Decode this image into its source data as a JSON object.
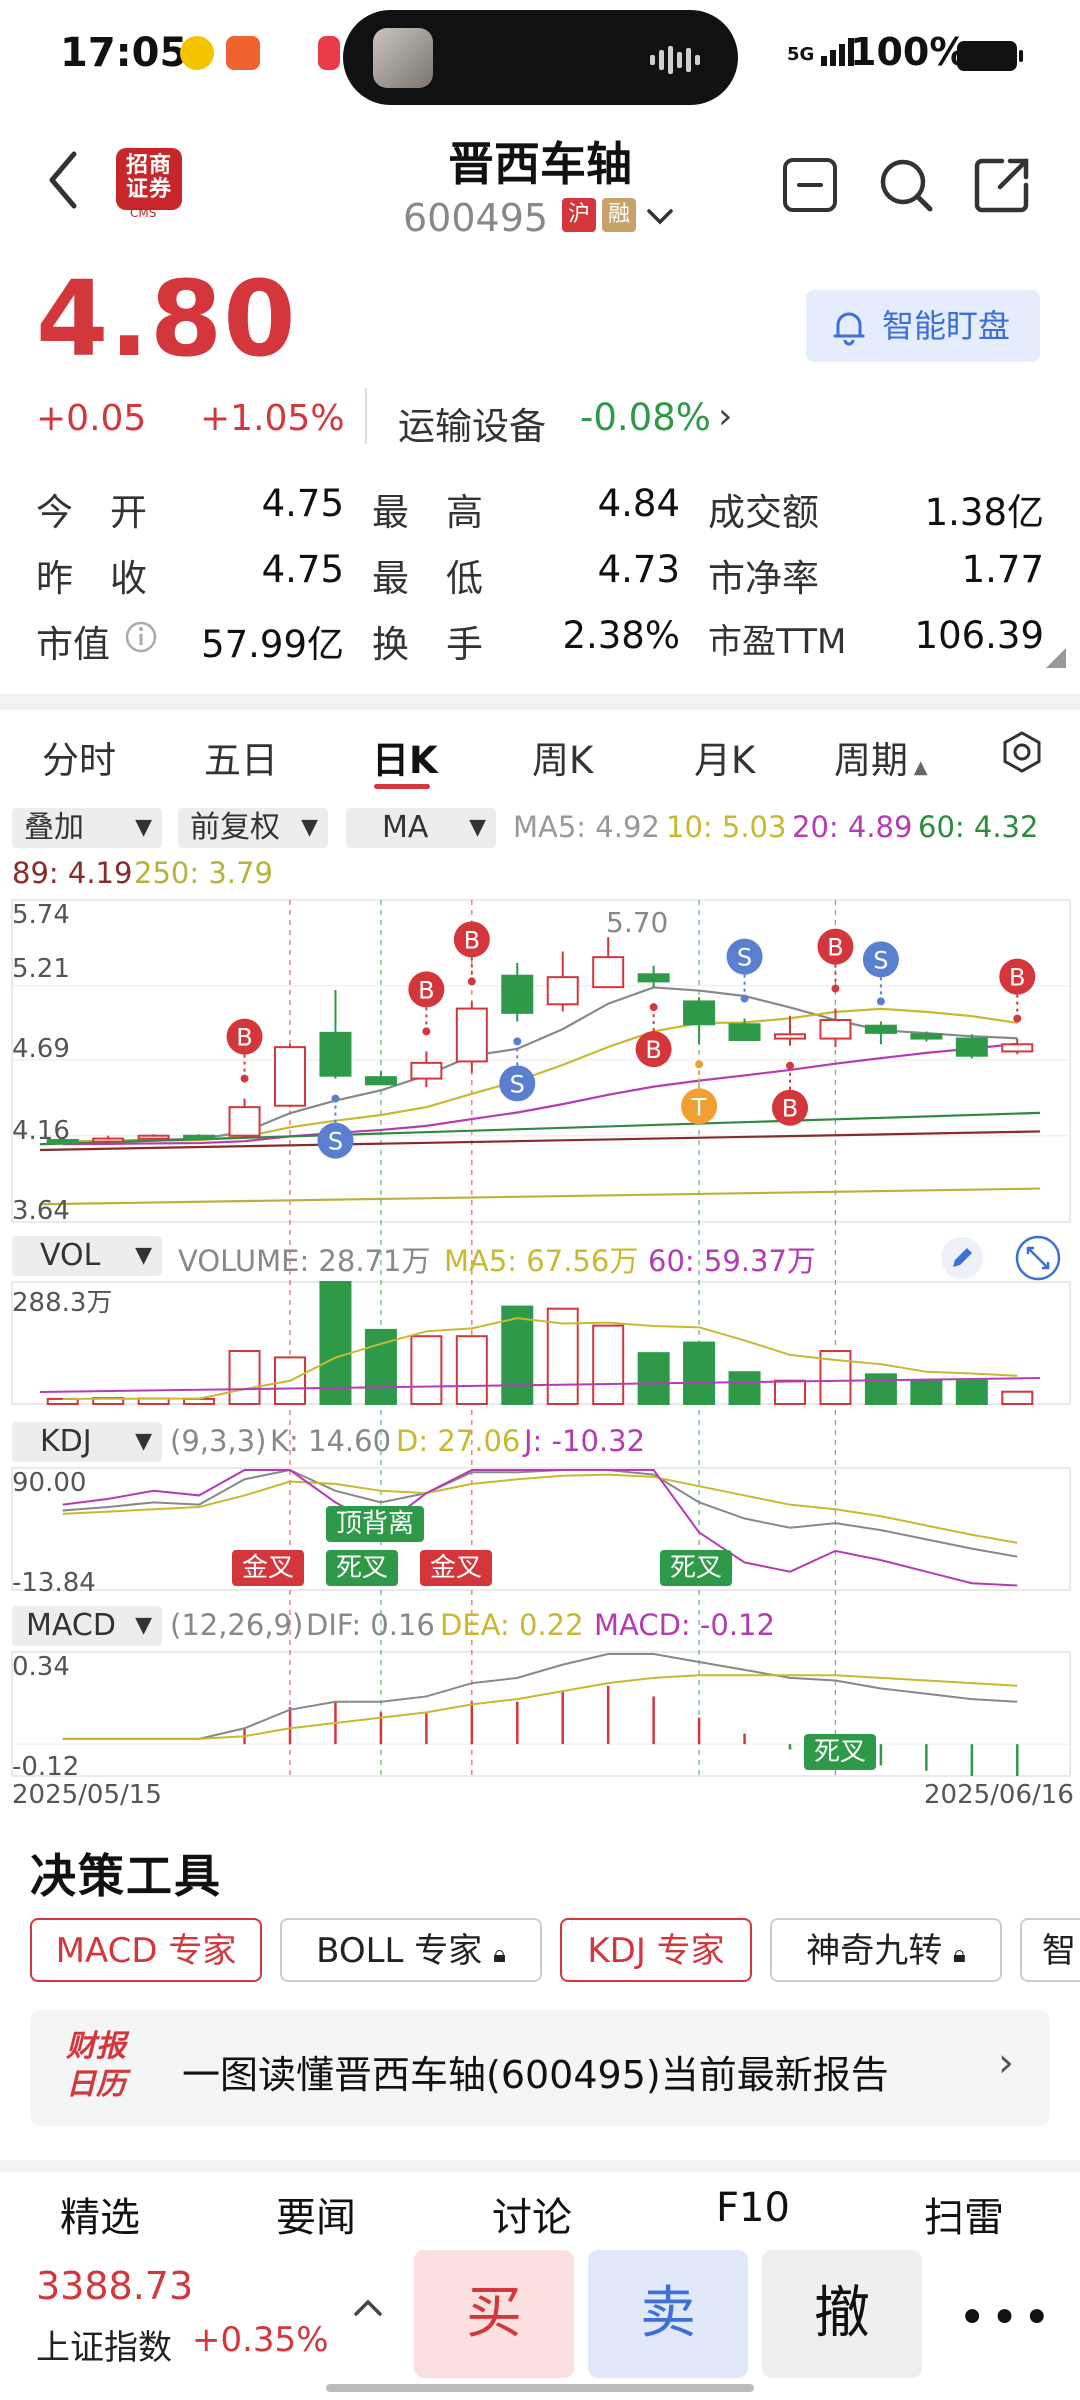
{
  "status_bar": {
    "time": "17:05",
    "network": "5G",
    "battery": "100%"
  },
  "header": {
    "broker_logo": "招商证券",
    "broker_logo_sub": "CMS",
    "stock_name": "晋西车轴",
    "stock_code": "600495",
    "tag_sh": "沪",
    "tag_margin": "融"
  },
  "quote": {
    "price": "4.80",
    "change": "+0.05",
    "change_pct": "+1.05%",
    "sector": "运输设备",
    "sector_change": "-0.08%",
    "smart_watch": "智能盯盘",
    "fields": {
      "open_label": "今　开",
      "open": "4.75",
      "high_label": "最　高",
      "high": "4.84",
      "amount_label": "成交额",
      "amount": "1.38亿",
      "prev_label": "昨　收",
      "prev": "4.75",
      "low_label": "最　低",
      "low": "4.73",
      "pb_label": "市净率",
      "pb": "1.77",
      "mcap_label": "市值",
      "mcap": "57.99亿",
      "turnover_label": "换　手",
      "turnover": "2.38%",
      "pe_label": "市盈TTM",
      "pe": "106.39"
    }
  },
  "tabs": [
    "分时",
    "五日",
    "日K",
    "周K",
    "月K",
    "周期"
  ],
  "selectors": {
    "overlay": "叠加",
    "adjust": "前复权",
    "ma": "MA"
  },
  "ma_legend": {
    "ma5": "MA5: 4.92",
    "ma10": "10: 5.03",
    "ma20": "20: 4.89",
    "ma60": "60: 4.32",
    "ma89": "89: 4.19",
    "ma250": "250: 3.79"
  },
  "colors": {
    "up": "#d3373c",
    "down": "#2e9a49",
    "ma5": "#888888",
    "ma10": "#c8b930",
    "ma20": "#b53bb5",
    "ma60": "#2e8a3e",
    "ma89": "#8a2b2b",
    "ma250": "#b9b23a",
    "signal_b": "#d3373c",
    "signal_s": "#5a7fd0",
    "signal_t": "#f0a030"
  },
  "chart_data": [
    {
      "type": "candlestick",
      "title": "日K",
      "y_ticks": [
        "5.74",
        "5.21",
        "4.69",
        "4.16",
        "3.64"
      ],
      "ylim": [
        3.64,
        5.74
      ],
      "peak_label": "5.70",
      "x_range_labels": [
        "2025/05/15",
        "2025/06/16"
      ],
      "candles": [
        {
          "o": 4.13,
          "h": 4.15,
          "l": 4.1,
          "c": 4.12
        },
        {
          "o": 4.12,
          "h": 4.16,
          "l": 4.1,
          "c": 4.14
        },
        {
          "o": 4.14,
          "h": 4.17,
          "l": 4.13,
          "c": 4.16
        },
        {
          "o": 4.16,
          "h": 4.17,
          "l": 4.14,
          "c": 4.15
        },
        {
          "o": 4.16,
          "h": 4.42,
          "l": 4.15,
          "c": 4.36
        },
        {
          "o": 4.37,
          "h": 4.8,
          "l": 4.36,
          "c": 4.78
        },
        {
          "o": 4.88,
          "h": 5.18,
          "l": 4.56,
          "c": 4.58
        },
        {
          "o": 4.57,
          "h": 4.61,
          "l": 4.52,
          "c": 4.52
        },
        {
          "o": 4.56,
          "h": 4.75,
          "l": 4.5,
          "c": 4.67
        },
        {
          "o": 4.68,
          "h": 5.1,
          "l": 4.6,
          "c": 5.05
        },
        {
          "o": 5.28,
          "h": 5.37,
          "l": 4.96,
          "c": 5.02
        },
        {
          "o": 5.08,
          "h": 5.45,
          "l": 5.03,
          "c": 5.27
        },
        {
          "o": 5.2,
          "h": 5.55,
          "l": 5.2,
          "c": 5.41
        },
        {
          "o": 5.29,
          "h": 5.35,
          "l": 5.2,
          "c": 5.24
        },
        {
          "o": 5.1,
          "h": 5.13,
          "l": 4.8,
          "c": 4.94
        },
        {
          "o": 4.94,
          "h": 4.98,
          "l": 4.83,
          "c": 4.83
        },
        {
          "o": 4.84,
          "h": 5.0,
          "l": 4.79,
          "c": 4.87
        },
        {
          "o": 4.84,
          "h": 5.05,
          "l": 4.78,
          "c": 4.97
        },
        {
          "o": 4.93,
          "h": 4.96,
          "l": 4.8,
          "c": 4.88
        },
        {
          "o": 4.87,
          "h": 4.89,
          "l": 4.82,
          "c": 4.84
        },
        {
          "o": 4.84,
          "h": 4.87,
          "l": 4.7,
          "c": 4.72
        },
        {
          "o": 4.75,
          "h": 4.84,
          "l": 4.73,
          "c": 4.8
        }
      ],
      "signals": [
        {
          "i": 4,
          "kind": "B"
        },
        {
          "i": 6,
          "kind": "S"
        },
        {
          "i": 8,
          "kind": "B"
        },
        {
          "i": 9,
          "kind": "B"
        },
        {
          "i": 10,
          "kind": "S"
        },
        {
          "i": 13,
          "kind": "B"
        },
        {
          "i": 14,
          "kind": "T"
        },
        {
          "i": 15,
          "kind": "S"
        },
        {
          "i": 16,
          "kind": "B"
        },
        {
          "i": 17,
          "kind": "B"
        },
        {
          "i": 18,
          "kind": "S"
        },
        {
          "i": 21,
          "kind": "B"
        }
      ]
    },
    {
      "type": "bar",
      "title": "VOL",
      "legend": {
        "volume": "VOLUME: 28.71万",
        "ma5": "MA5: 67.56万",
        "ma60": "60: 59.37万"
      },
      "y_max_label": "288.3万",
      "values": [
        12,
        14,
        13,
        12,
        125,
        110,
        288,
        175,
        160,
        160,
        230,
        225,
        185,
        120,
        145,
        75,
        55,
        125,
        70,
        55,
        55,
        29
      ],
      "directions": [
        "up",
        "up",
        "up",
        "up",
        "up",
        "up",
        "down",
        "down",
        "up",
        "up",
        "down",
        "up",
        "up",
        "down",
        "down",
        "down",
        "up",
        "up",
        "down",
        "down",
        "down",
        "up"
      ]
    },
    {
      "type": "line",
      "title": "KDJ",
      "legend": {
        "params": "(9,3,3)",
        "k": "K: 14.60",
        "d": "D: 27.06",
        "j": "J: -10.32"
      },
      "y_ticks": [
        "90.00",
        "-13.84"
      ],
      "annotations": [
        "顶背离",
        "金叉",
        "死叉",
        "金叉",
        "死叉"
      ]
    },
    {
      "type": "bar",
      "title": "MACD",
      "legend": {
        "params": "(12,26,9)",
        "dif": "DIF: 0.16",
        "dea": "DEA: 0.22",
        "macd": "MACD: -0.12"
      },
      "y_ticks": [
        "0.34",
        "-0.12"
      ],
      "annotations": [
        "死叉"
      ]
    }
  ],
  "tools": {
    "title": "决策工具",
    "buttons": [
      "MACD 专家",
      "BOLL 专家",
      "KDJ 专家",
      "神奇九转",
      "智"
    ],
    "report_logo": "财报日历",
    "report_text": "一图读懂晋西车轴(600495)当前最新报告"
  },
  "bottom_tabs": [
    "精选",
    "要闻",
    "讨论",
    "F10",
    "扫雷"
  ],
  "index": {
    "value": "3388.73",
    "name": "上证指数",
    "pct": "+0.35%"
  },
  "actions": {
    "buy": "买",
    "sell": "卖",
    "cancel": "撤",
    "more": "•••"
  }
}
